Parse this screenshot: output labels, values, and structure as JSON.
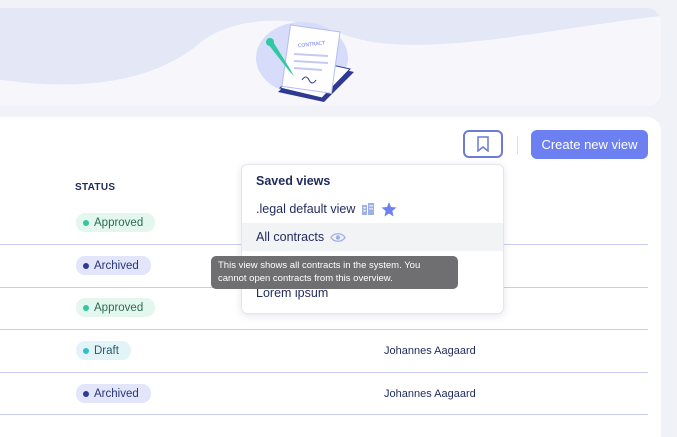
{
  "header": {
    "illustration_icon": "contract-signing-illustration",
    "illustration_text": "CONTRACT"
  },
  "toolbar": {
    "bookmark_icon": "bookmark-icon",
    "create_view_label": "Create new view"
  },
  "table": {
    "status_header": "STATUS",
    "rows": [
      {
        "status": "Approved",
        "owner": ""
      },
      {
        "status": "Archived",
        "owner": ""
      },
      {
        "status": "Approved",
        "owner": ""
      },
      {
        "status": "Draft",
        "owner": "Johannes Aagaard"
      },
      {
        "status": "Archived",
        "owner": "Johannes Aagaard"
      }
    ]
  },
  "saved_views": {
    "title": "Saved views",
    "items": [
      {
        "label": ".legal default view",
        "icons": [
          "building-icon",
          "star-icon"
        ]
      },
      {
        "label": "All contracts",
        "icons": [
          "eye-icon"
        ]
      },
      {
        "label": "Lorem ipsum",
        "icons": []
      }
    ]
  },
  "tooltip": {
    "text": "This view shows all contracts in the system. You cannot open contracts from this overview."
  },
  "colors": {
    "accent": "#6d80f2",
    "approved": "#2fc8a0",
    "archived": "#2e3a92",
    "draft": "#2fc0d0"
  }
}
